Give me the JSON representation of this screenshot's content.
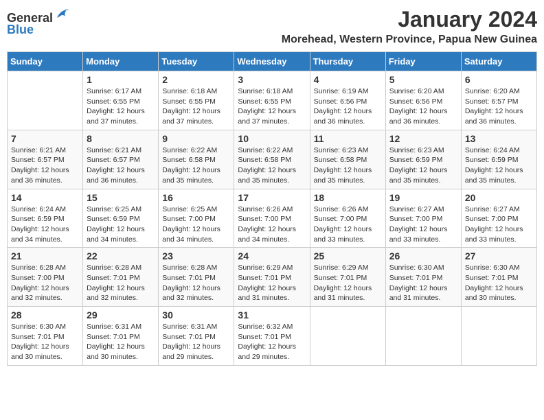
{
  "logo": {
    "general": "General",
    "blue": "Blue"
  },
  "title": "January 2024",
  "subtitle": "Morehead, Western Province, Papua New Guinea",
  "days_of_week": [
    "Sunday",
    "Monday",
    "Tuesday",
    "Wednesday",
    "Thursday",
    "Friday",
    "Saturday"
  ],
  "weeks": [
    [
      {
        "day": "",
        "sunrise": "",
        "sunset": "",
        "daylight": ""
      },
      {
        "day": "1",
        "sunrise": "Sunrise: 6:17 AM",
        "sunset": "Sunset: 6:55 PM",
        "daylight": "Daylight: 12 hours and 37 minutes."
      },
      {
        "day": "2",
        "sunrise": "Sunrise: 6:18 AM",
        "sunset": "Sunset: 6:55 PM",
        "daylight": "Daylight: 12 hours and 37 minutes."
      },
      {
        "day": "3",
        "sunrise": "Sunrise: 6:18 AM",
        "sunset": "Sunset: 6:55 PM",
        "daylight": "Daylight: 12 hours and 37 minutes."
      },
      {
        "day": "4",
        "sunrise": "Sunrise: 6:19 AM",
        "sunset": "Sunset: 6:56 PM",
        "daylight": "Daylight: 12 hours and 36 minutes."
      },
      {
        "day": "5",
        "sunrise": "Sunrise: 6:20 AM",
        "sunset": "Sunset: 6:56 PM",
        "daylight": "Daylight: 12 hours and 36 minutes."
      },
      {
        "day": "6",
        "sunrise": "Sunrise: 6:20 AM",
        "sunset": "Sunset: 6:57 PM",
        "daylight": "Daylight: 12 hours and 36 minutes."
      }
    ],
    [
      {
        "day": "7",
        "sunrise": "Sunrise: 6:21 AM",
        "sunset": "Sunset: 6:57 PM",
        "daylight": "Daylight: 12 hours and 36 minutes."
      },
      {
        "day": "8",
        "sunrise": "Sunrise: 6:21 AM",
        "sunset": "Sunset: 6:57 PM",
        "daylight": "Daylight: 12 hours and 36 minutes."
      },
      {
        "day": "9",
        "sunrise": "Sunrise: 6:22 AM",
        "sunset": "Sunset: 6:58 PM",
        "daylight": "Daylight: 12 hours and 35 minutes."
      },
      {
        "day": "10",
        "sunrise": "Sunrise: 6:22 AM",
        "sunset": "Sunset: 6:58 PM",
        "daylight": "Daylight: 12 hours and 35 minutes."
      },
      {
        "day": "11",
        "sunrise": "Sunrise: 6:23 AM",
        "sunset": "Sunset: 6:58 PM",
        "daylight": "Daylight: 12 hours and 35 minutes."
      },
      {
        "day": "12",
        "sunrise": "Sunrise: 6:23 AM",
        "sunset": "Sunset: 6:59 PM",
        "daylight": "Daylight: 12 hours and 35 minutes."
      },
      {
        "day": "13",
        "sunrise": "Sunrise: 6:24 AM",
        "sunset": "Sunset: 6:59 PM",
        "daylight": "Daylight: 12 hours and 35 minutes."
      }
    ],
    [
      {
        "day": "14",
        "sunrise": "Sunrise: 6:24 AM",
        "sunset": "Sunset: 6:59 PM",
        "daylight": "Daylight: 12 hours and 34 minutes."
      },
      {
        "day": "15",
        "sunrise": "Sunrise: 6:25 AM",
        "sunset": "Sunset: 6:59 PM",
        "daylight": "Daylight: 12 hours and 34 minutes."
      },
      {
        "day": "16",
        "sunrise": "Sunrise: 6:25 AM",
        "sunset": "Sunset: 7:00 PM",
        "daylight": "Daylight: 12 hours and 34 minutes."
      },
      {
        "day": "17",
        "sunrise": "Sunrise: 6:26 AM",
        "sunset": "Sunset: 7:00 PM",
        "daylight": "Daylight: 12 hours and 34 minutes."
      },
      {
        "day": "18",
        "sunrise": "Sunrise: 6:26 AM",
        "sunset": "Sunset: 7:00 PM",
        "daylight": "Daylight: 12 hours and 33 minutes."
      },
      {
        "day": "19",
        "sunrise": "Sunrise: 6:27 AM",
        "sunset": "Sunset: 7:00 PM",
        "daylight": "Daylight: 12 hours and 33 minutes."
      },
      {
        "day": "20",
        "sunrise": "Sunrise: 6:27 AM",
        "sunset": "Sunset: 7:00 PM",
        "daylight": "Daylight: 12 hours and 33 minutes."
      }
    ],
    [
      {
        "day": "21",
        "sunrise": "Sunrise: 6:28 AM",
        "sunset": "Sunset: 7:00 PM",
        "daylight": "Daylight: 12 hours and 32 minutes."
      },
      {
        "day": "22",
        "sunrise": "Sunrise: 6:28 AM",
        "sunset": "Sunset: 7:01 PM",
        "daylight": "Daylight: 12 hours and 32 minutes."
      },
      {
        "day": "23",
        "sunrise": "Sunrise: 6:28 AM",
        "sunset": "Sunset: 7:01 PM",
        "daylight": "Daylight: 12 hours and 32 minutes."
      },
      {
        "day": "24",
        "sunrise": "Sunrise: 6:29 AM",
        "sunset": "Sunset: 7:01 PM",
        "daylight": "Daylight: 12 hours and 31 minutes."
      },
      {
        "day": "25",
        "sunrise": "Sunrise: 6:29 AM",
        "sunset": "Sunset: 7:01 PM",
        "daylight": "Daylight: 12 hours and 31 minutes."
      },
      {
        "day": "26",
        "sunrise": "Sunrise: 6:30 AM",
        "sunset": "Sunset: 7:01 PM",
        "daylight": "Daylight: 12 hours and 31 minutes."
      },
      {
        "day": "27",
        "sunrise": "Sunrise: 6:30 AM",
        "sunset": "Sunset: 7:01 PM",
        "daylight": "Daylight: 12 hours and 30 minutes."
      }
    ],
    [
      {
        "day": "28",
        "sunrise": "Sunrise: 6:30 AM",
        "sunset": "Sunset: 7:01 PM",
        "daylight": "Daylight: 12 hours and 30 minutes."
      },
      {
        "day": "29",
        "sunrise": "Sunrise: 6:31 AM",
        "sunset": "Sunset: 7:01 PM",
        "daylight": "Daylight: 12 hours and 30 minutes."
      },
      {
        "day": "30",
        "sunrise": "Sunrise: 6:31 AM",
        "sunset": "Sunset: 7:01 PM",
        "daylight": "Daylight: 12 hours and 29 minutes."
      },
      {
        "day": "31",
        "sunrise": "Sunrise: 6:32 AM",
        "sunset": "Sunset: 7:01 PM",
        "daylight": "Daylight: 12 hours and 29 minutes."
      },
      {
        "day": "",
        "sunrise": "",
        "sunset": "",
        "daylight": ""
      },
      {
        "day": "",
        "sunrise": "",
        "sunset": "",
        "daylight": ""
      },
      {
        "day": "",
        "sunrise": "",
        "sunset": "",
        "daylight": ""
      }
    ]
  ]
}
